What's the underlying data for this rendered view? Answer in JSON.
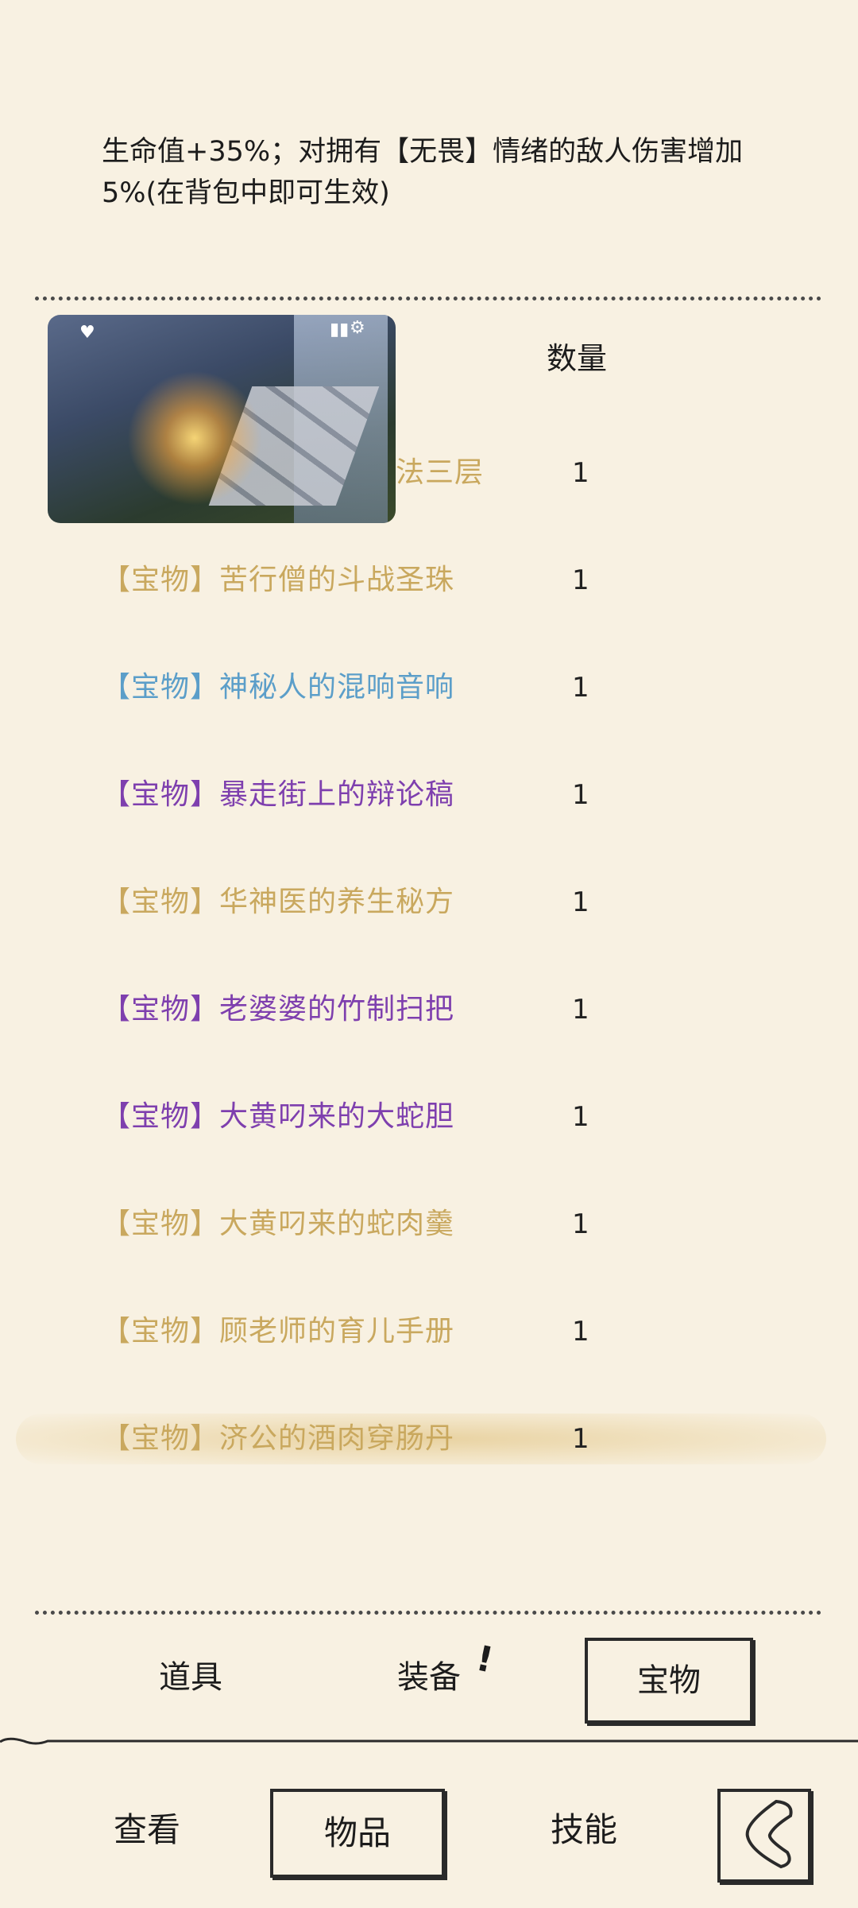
{
  "description": "生命值+35%；对拥有【无畏】情绪的敌人伤害增加5%(在背包中即可生效)",
  "column_header": "数量",
  "first_row_partial": "法三层",
  "rows": [
    {
      "name": "【宝物】苦行僧的斗战圣珠",
      "qty": "1",
      "color": "#c9a85e"
    },
    {
      "name": "【宝物】神秘人的混响音响",
      "qty": "1",
      "color": "#5b9ec9"
    },
    {
      "name": "【宝物】暴走街上的辩论稿",
      "qty": "1",
      "color": "#7e3fae"
    },
    {
      "name": "【宝物】华神医的养生秘方",
      "qty": "1",
      "color": "#c9a85e"
    },
    {
      "name": "【宝物】老婆婆的竹制扫把",
      "qty": "1",
      "color": "#7e3fae"
    },
    {
      "name": "【宝物】大黄叼来的大蛇胆",
      "qty": "1",
      "color": "#7e3fae"
    },
    {
      "name": "【宝物】大黄叼来的蛇肉羹",
      "qty": "1",
      "color": "#c9a85e"
    },
    {
      "name": "【宝物】顾老师的育儿手册",
      "qty": "1",
      "color": "#c9a85e"
    },
    {
      "name": "【宝物】济公的酒肉穿肠丹",
      "qty": "1",
      "color": "#c9a85e",
      "selected": true
    }
  ],
  "first_row_qty": "1",
  "sub_tabs": {
    "items": "道具",
    "equipment": "装备",
    "treasure": "宝物",
    "active": "宝物"
  },
  "bottom_nav": {
    "view": "查看",
    "goods": "物品",
    "skills": "技能",
    "active": "物品"
  }
}
